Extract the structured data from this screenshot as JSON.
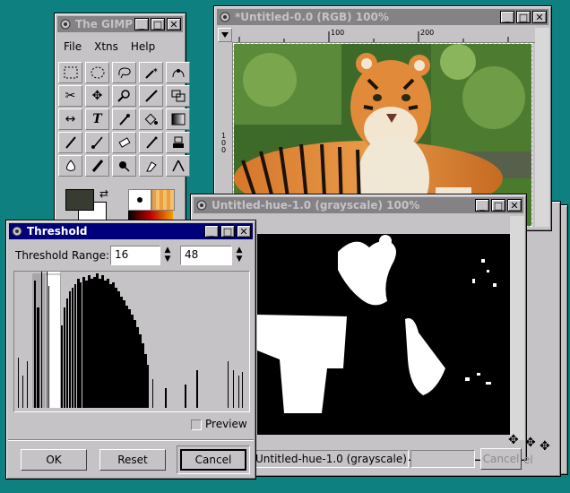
{
  "toolbox": {
    "title": "The GIMP",
    "menu": [
      "File",
      "Xtns",
      "Help"
    ],
    "tools": [
      "rect-select",
      "ellipse-select",
      "free-select",
      "fuzzy-select",
      "bezier-select",
      "scissors",
      "move",
      "magnify",
      "crop",
      "transform",
      "flip",
      "text",
      "color-picker",
      "bucket-fill",
      "blend",
      "pencil",
      "paintbrush",
      "eraser",
      "airbrush",
      "clone",
      "convolve",
      "ink",
      "dodge-burn",
      "smudge",
      "measure"
    ],
    "fg_color": "#383c30",
    "bg_color": "#ffffff"
  },
  "image_window": {
    "title": "*Untitled-0.0 (RGB) 100%",
    "ruler_ticks": [
      "100",
      "200"
    ],
    "v_ruler_ticks": [
      "1",
      "0",
      "0"
    ]
  },
  "hue_window": {
    "title": "Untitled-hue-1.0 (grayscale) 100%"
  },
  "back_windows": {
    "status_text": "Untitled-hue-1.0 (grayscale) 10",
    "cancel_label": "Cancel",
    "cancel_label_2": "el"
  },
  "threshold": {
    "title": "Threshold",
    "range_label": "Threshold Range:",
    "low": "16",
    "high": "48",
    "preview_label": "Preview",
    "ok": "OK",
    "reset": "Reset",
    "cancel": "Cancel"
  }
}
